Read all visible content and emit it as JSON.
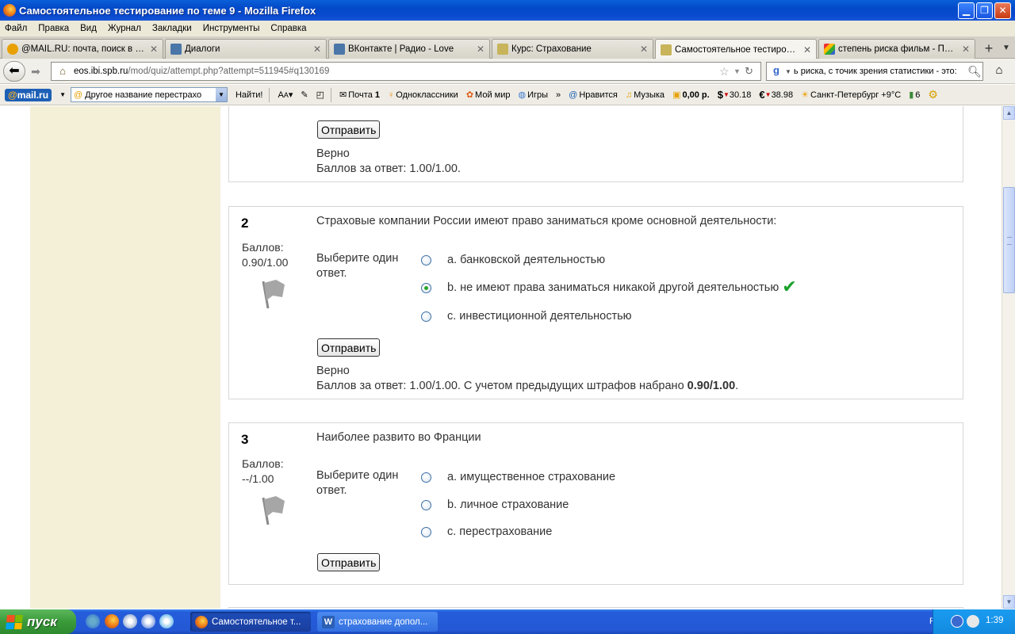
{
  "window": {
    "title": "Самостоятельное тестирование по теме 9 - Mozilla Firefox"
  },
  "menu": [
    "Файл",
    "Правка",
    "Вид",
    "Журнал",
    "Закладки",
    "Инструменты",
    "Справка"
  ],
  "tabs": [
    {
      "label": "@MAIL.RU: почта, поиск в ин...",
      "icon_color": "#e8a000"
    },
    {
      "label": "Диалоги",
      "icon_color": "#4a76a8"
    },
    {
      "label": "ВКонтакте | Радио - Love",
      "icon_color": "#4a76a8"
    },
    {
      "label": "Курс: Страхование",
      "icon_color": "#8a7a2a"
    },
    {
      "label": "Самостоятельное тестирован...",
      "icon_color": "#8a7a2a"
    },
    {
      "label": "степень риска фильм - Поиск ...",
      "icon_color": "#3c8a3c"
    }
  ],
  "nav": {
    "url_host": "eos.ibi.spb.ru",
    "url_path": "/mod/quiz/attempt.php?attempt=511945#q130169",
    "search_value": "ь риска, с точик зрения статистики - это:"
  },
  "mailbar": {
    "logo_at": "@",
    "logo_text": "mail.ru",
    "search_value": "Другое название перестрахо",
    "find": "Найти!",
    "mail_label": "Почта",
    "mail_count": "1",
    "odnoklassniki": "Одноклассники",
    "moi_mir": "Мой мир",
    "igry": "Игры",
    "more": "»",
    "nravitsya": "Нравится",
    "muzyka": "Музыка",
    "balance": "0,00 р.",
    "usd": "30.18",
    "eur": "38.98",
    "weather": "Санкт-Петербург +9°C",
    "traffic": "6"
  },
  "questions": [
    {
      "submit": "Отправить",
      "outcome": "Верно",
      "score_line": "Баллов за ответ: 1.00/1.00."
    },
    {
      "number": "2",
      "grade_label": "Баллов:",
      "grade_value": "0.90/1.00",
      "text": "Страховые компании России имеют право заниматься кроме основной деятельности:",
      "prompt": "Выберите один ответ.",
      "answers": [
        {
          "label": "a. банковской деятельностью",
          "checked": false
        },
        {
          "label": "b. не имеют права заниматься никакой другой деятельностью",
          "checked": true,
          "correct": true
        },
        {
          "label": "c. инвестиционной деятельностью",
          "checked": false
        }
      ],
      "submit": "Отправить",
      "outcome": "Верно",
      "score_line": "Баллов за ответ: 1.00/1.00. С учетом предыдущих штрафов набрано",
      "score_bold": "0.90/1.00",
      "score_end": "."
    },
    {
      "number": "3",
      "grade_label": "Баллов:",
      "grade_value": "--/1.00",
      "text": "Наиболее развито во Франции",
      "prompt": "Выберите один ответ.",
      "answers": [
        {
          "label": "a. имущественное страхование",
          "checked": false
        },
        {
          "label": "b. личное страхование",
          "checked": false
        },
        {
          "label": "c. перестрахование",
          "checked": false
        }
      ],
      "submit": "Отправить"
    }
  ],
  "taskbar": {
    "start": "пуск",
    "tasks": [
      {
        "label": "Самостоятельное т...",
        "icon_color": "#e86a10"
      },
      {
        "label": "страхование допол...",
        "icon_color": "#2b5fb4"
      }
    ],
    "lang": "RL",
    "time": "1:39"
  }
}
